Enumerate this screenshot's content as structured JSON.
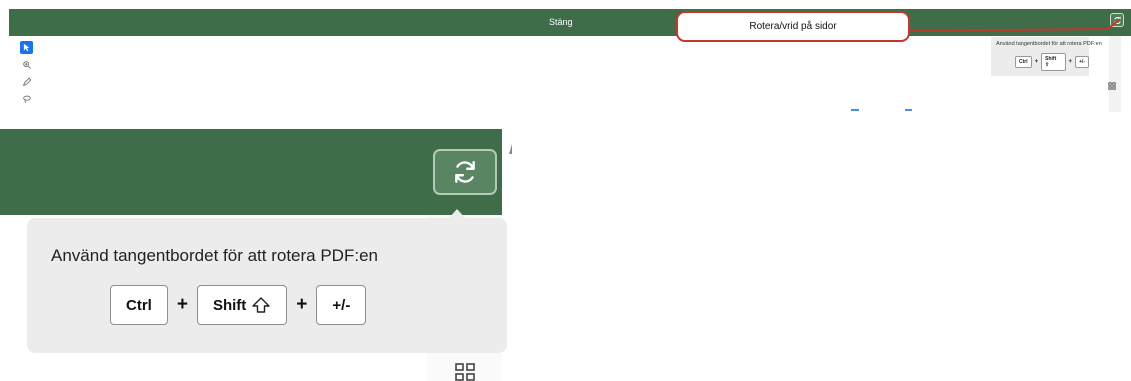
{
  "top_view": {
    "toolbar_center_label": "Stäng",
    "rotate_icon": "rotate-icon",
    "tools": [
      {
        "icon": "pointer-icon",
        "active": true
      },
      {
        "icon": "zoom-icon",
        "active": false
      },
      {
        "icon": "pen-icon",
        "active": false
      },
      {
        "icon": "lasso-icon",
        "active": false
      }
    ],
    "hint": {
      "text": "Använd tangentbordet för att rotera PDF:en",
      "keys": [
        "Ctrl",
        "Shift",
        "+/-"
      ],
      "plus": "+"
    }
  },
  "callout": {
    "text": "Rotera/vrid på sidor",
    "border_color": "#c0392b"
  },
  "zoom_view": {
    "rotate_icon": "rotate-icon",
    "hint": {
      "text": "Använd tangentbordet för att rotera PDF:en",
      "key_ctrl": "Ctrl",
      "key_shift": "Shift",
      "key_shift_icon": "shift-arrow-icon",
      "key_plusminus": "+/-",
      "plus": "+"
    },
    "grid_icon": "grid-view-icon"
  },
  "colors": {
    "toolbar_green": "#3f6d4a",
    "hint_background": "#ececec",
    "active_tool": "#1a73e8"
  }
}
